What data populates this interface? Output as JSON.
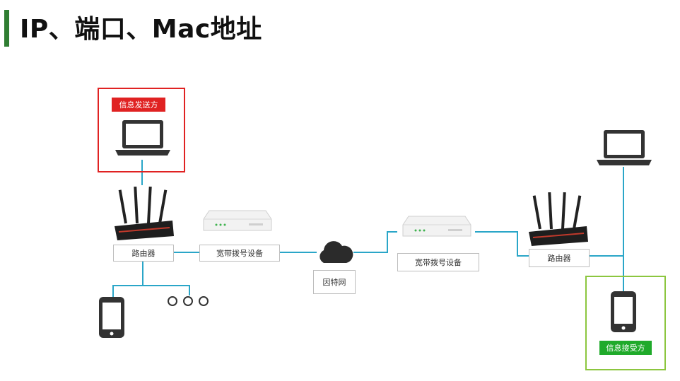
{
  "title": "IP、端口、Mac地址",
  "colors": {
    "title_accent": "#2f7d32",
    "link": "#2aa6c8",
    "sender": "#e02222",
    "receiver": "#8cc63f",
    "receiver_tag": "#1faa2a"
  },
  "diagram": {
    "sender_tag": "信息发送方",
    "receiver_tag": "信息接受方",
    "router_left": "路由器",
    "router_right": "路由器",
    "modem_left": "宽带拨号设备",
    "modem_right": "宽带拨号设备",
    "internet": "因特网"
  },
  "icons": [
    "laptop-icon",
    "router-icon",
    "modem-icon",
    "cloud-icon",
    "phone-icon",
    "more-devices-icon"
  ]
}
